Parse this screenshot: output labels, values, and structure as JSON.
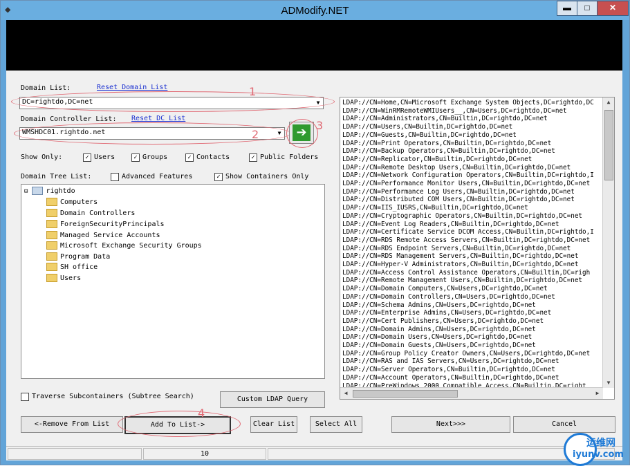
{
  "window": {
    "title": "ADModify.NET",
    "minimize": "▬",
    "maximize": "□",
    "close": "✕",
    "app_icon": "app-icon"
  },
  "domain_list": {
    "label": "Domain List:",
    "reset_link": "Reset Domain List",
    "value": "DC=rightdo,DC=net"
  },
  "dc_list": {
    "label": "Domain Controller List:",
    "reset_link": "Reset DC List",
    "value": "WMSHDC01.rightdo.net"
  },
  "go_button": {
    "glyph": "➔"
  },
  "show_only": {
    "label": "Show Only:",
    "users": "Users",
    "groups": "Groups",
    "contacts": "Contacts",
    "public_folders": "Public Folders"
  },
  "domain_tree": {
    "label": "Domain Tree List:",
    "advanced": "Advanced Features",
    "containers_only": "Show Containers Only"
  },
  "tree": {
    "root": "rightdo",
    "items": [
      "Computers",
      "Domain Controllers",
      "ForeignSecurityPrincipals",
      "Managed Service Accounts",
      "Microsoft Exchange Security Groups",
      "Program Data",
      "SH office",
      "Users"
    ]
  },
  "ldap_items": [
    "LDAP://CN=Home,CN=Microsoft Exchange System Objects,DC=rightdo,DC",
    "LDAP://CN=WinRMRemoteWMIUsers__,CN=Users,DC=rightdo,DC=net",
    "LDAP://CN=Administrators,CN=Builtin,DC=rightdo,DC=net",
    "LDAP://CN=Users,CN=Builtin,DC=rightdo,DC=net",
    "LDAP://CN=Guests,CN=Builtin,DC=rightdo,DC=net",
    "LDAP://CN=Print Operators,CN=Builtin,DC=rightdo,DC=net",
    "LDAP://CN=Backup Operators,CN=Builtin,DC=rightdo,DC=net",
    "LDAP://CN=Replicator,CN=Builtin,DC=rightdo,DC=net",
    "LDAP://CN=Remote Desktop Users,CN=Builtin,DC=rightdo,DC=net",
    "LDAP://CN=Network Configuration Operators,CN=Builtin,DC=rightdo,I",
    "LDAP://CN=Performance Monitor Users,CN=Builtin,DC=rightdo,DC=net",
    "LDAP://CN=Performance Log Users,CN=Builtin,DC=rightdo,DC=net",
    "LDAP://CN=Distributed COM Users,CN=Builtin,DC=rightdo,DC=net",
    "LDAP://CN=IIS_IUSRS,CN=Builtin,DC=rightdo,DC=net",
    "LDAP://CN=Cryptographic Operators,CN=Builtin,DC=rightdo,DC=net",
    "LDAP://CN=Event Log Readers,CN=Builtin,DC=rightdo,DC=net",
    "LDAP://CN=Certificate Service DCOM Access,CN=Builtin,DC=rightdo,I",
    "LDAP://CN=RDS Remote Access Servers,CN=Builtin,DC=rightdo,DC=net",
    "LDAP://CN=RDS Endpoint Servers,CN=Builtin,DC=rightdo,DC=net",
    "LDAP://CN=RDS Management Servers,CN=Builtin,DC=rightdo,DC=net",
    "LDAP://CN=Hyper-V Administrators,CN=Builtin,DC=rightdo,DC=net",
    "LDAP://CN=Access Control Assistance Operators,CN=Builtin,DC=righ",
    "LDAP://CN=Remote Management Users,CN=Builtin,DC=rightdo,DC=net",
    "LDAP://CN=Domain Computers,CN=Users,DC=rightdo,DC=net",
    "LDAP://CN=Domain Controllers,CN=Users,DC=rightdo,DC=net",
    "LDAP://CN=Schema Admins,CN=Users,DC=rightdo,DC=net",
    "LDAP://CN=Enterprise Admins,CN=Users,DC=rightdo,DC=net",
    "LDAP://CN=Cert Publishers,CN=Users,DC=rightdo,DC=net",
    "LDAP://CN=Domain Admins,CN=Users,DC=rightdo,DC=net",
    "LDAP://CN=Domain Users,CN=Users,DC=rightdo,DC=net",
    "LDAP://CN=Domain Guests,CN=Users,DC=rightdo,DC=net",
    "LDAP://CN=Group Policy Creator Owners,CN=Users,DC=rightdo,DC=net",
    "LDAP://CN=RAS and IAS Servers,CN=Users,DC=rightdo,DC=net",
    "LDAP://CN=Server Operators,CN=Builtin,DC=rightdo,DC=net",
    "LDAP://CN=Account Operators,CN=Builtin,DC=rightdo,DC=net",
    "LDAP://CN=PreWindows 2000 Compatible Access,CN=Builtin,DC=right"
  ],
  "traverse": {
    "label": "Traverse Subcontainers (Subtree Search)"
  },
  "buttons": {
    "custom_ldap": "Custom LDAP Query",
    "remove": "<-Remove From List",
    "add": "Add To List->",
    "clear": "Clear List",
    "select_all": "Select All",
    "next": "Next>>>",
    "cancel": "Cancel"
  },
  "annotations": {
    "n1": "1",
    "n2": "2",
    "n3": "3",
    "n4": "4"
  },
  "status": {
    "count": "10"
  },
  "watermark": {
    "cn": "运维网",
    "url": "iyunv.com"
  },
  "colors": {
    "title_bar": "#6aaee0",
    "annotation": "#e06a74",
    "link": "#1a2fd0",
    "go_green": "#2f9a2f"
  }
}
